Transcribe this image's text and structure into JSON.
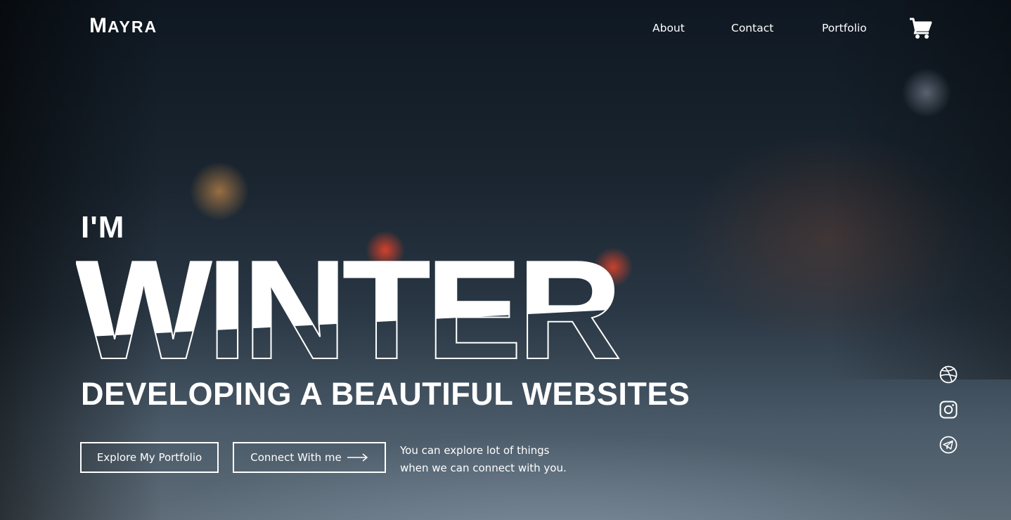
{
  "brand": {
    "logo_first": "M",
    "logo_rest": "AYRA"
  },
  "nav": {
    "items": [
      {
        "label": "About"
      },
      {
        "label": "Contact"
      },
      {
        "label": "Portfolio"
      }
    ],
    "cart_icon": "shopping-cart-icon"
  },
  "hero": {
    "intro": "I'M",
    "name": "WINTER",
    "headline": "DEVELOPING A BEAUTIFUL WEBSITES",
    "primary_button": "Explore My Portfolio",
    "secondary_button": "Connect With me",
    "secondary_button_icon": "long-arrow-right-icon",
    "tagline_line1": "You can explore lot of things",
    "tagline_line2": "when we can connect with you."
  },
  "social": [
    {
      "icon": "dribbble-icon"
    },
    {
      "icon": "instagram-icon"
    },
    {
      "icon": "telegram-icon"
    }
  ],
  "colors": {
    "text": "#ffffff",
    "overlay_dark": "#1b2633"
  }
}
